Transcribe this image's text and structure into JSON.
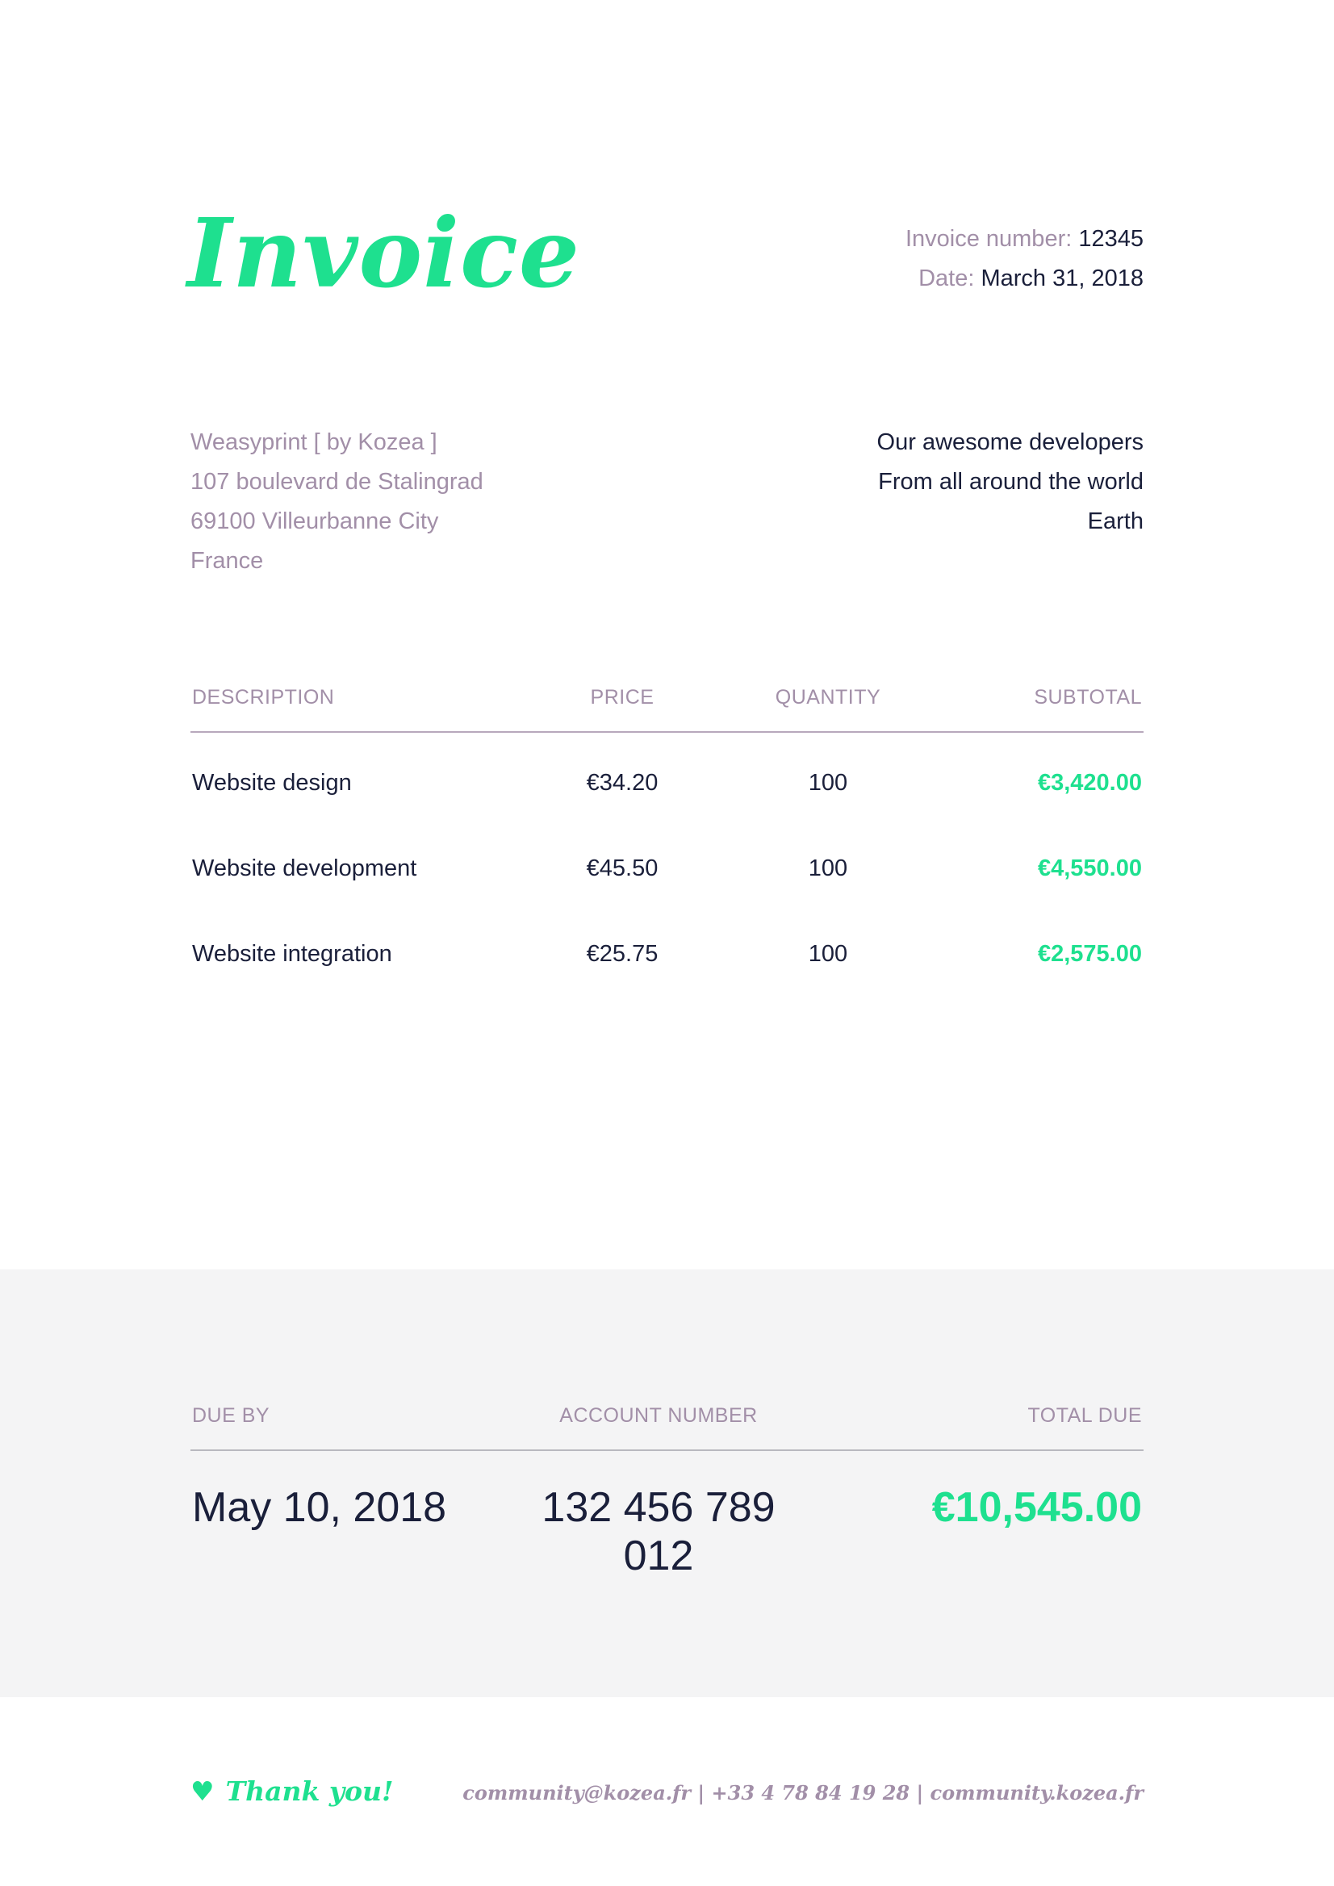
{
  "header": {
    "title": "Invoice",
    "invoice_number_label": "Invoice number:",
    "invoice_number": "12345",
    "date_label": "Date:",
    "date": "March 31, 2018"
  },
  "from": {
    "lines": [
      "Weasyprint [ by Kozea ]",
      "107 boulevard de Stalingrad",
      "69100 Villeurbanne City",
      "France"
    ]
  },
  "to": {
    "lines": [
      "Our awesome developers",
      "From all around the world",
      "Earth"
    ]
  },
  "items": {
    "headers": {
      "description": "DESCRIPTION",
      "price": "PRICE",
      "quantity": "QUANTITY",
      "subtotal": "SUBTOTAL"
    },
    "rows": [
      {
        "description": "Website design",
        "price": "€34.20",
        "quantity": "100",
        "subtotal": "€3,420.00"
      },
      {
        "description": "Website development",
        "price": "€45.50",
        "quantity": "100",
        "subtotal": "€4,550.00"
      },
      {
        "description": "Website integration",
        "price": "€25.75",
        "quantity": "100",
        "subtotal": "€2,575.00"
      }
    ]
  },
  "summary": {
    "headers": {
      "due_by": "DUE BY",
      "account_number": "ACCOUNT NUMBER",
      "total_due": "TOTAL DUE"
    },
    "due_by": "May 10, 2018",
    "account_number": "132 456 789 012",
    "total_due": "€10,545.00"
  },
  "footer": {
    "heart_icon": "heart-icon",
    "thanks": "Thank you!",
    "contact": "community@kozea.fr | +33 4 78 84 19 28 | community.kozea.fr"
  },
  "colors": {
    "accent": "#1ee08f",
    "muted": "#a28fa8",
    "text": "#1a1f3a",
    "band": "#f4f4f5"
  }
}
